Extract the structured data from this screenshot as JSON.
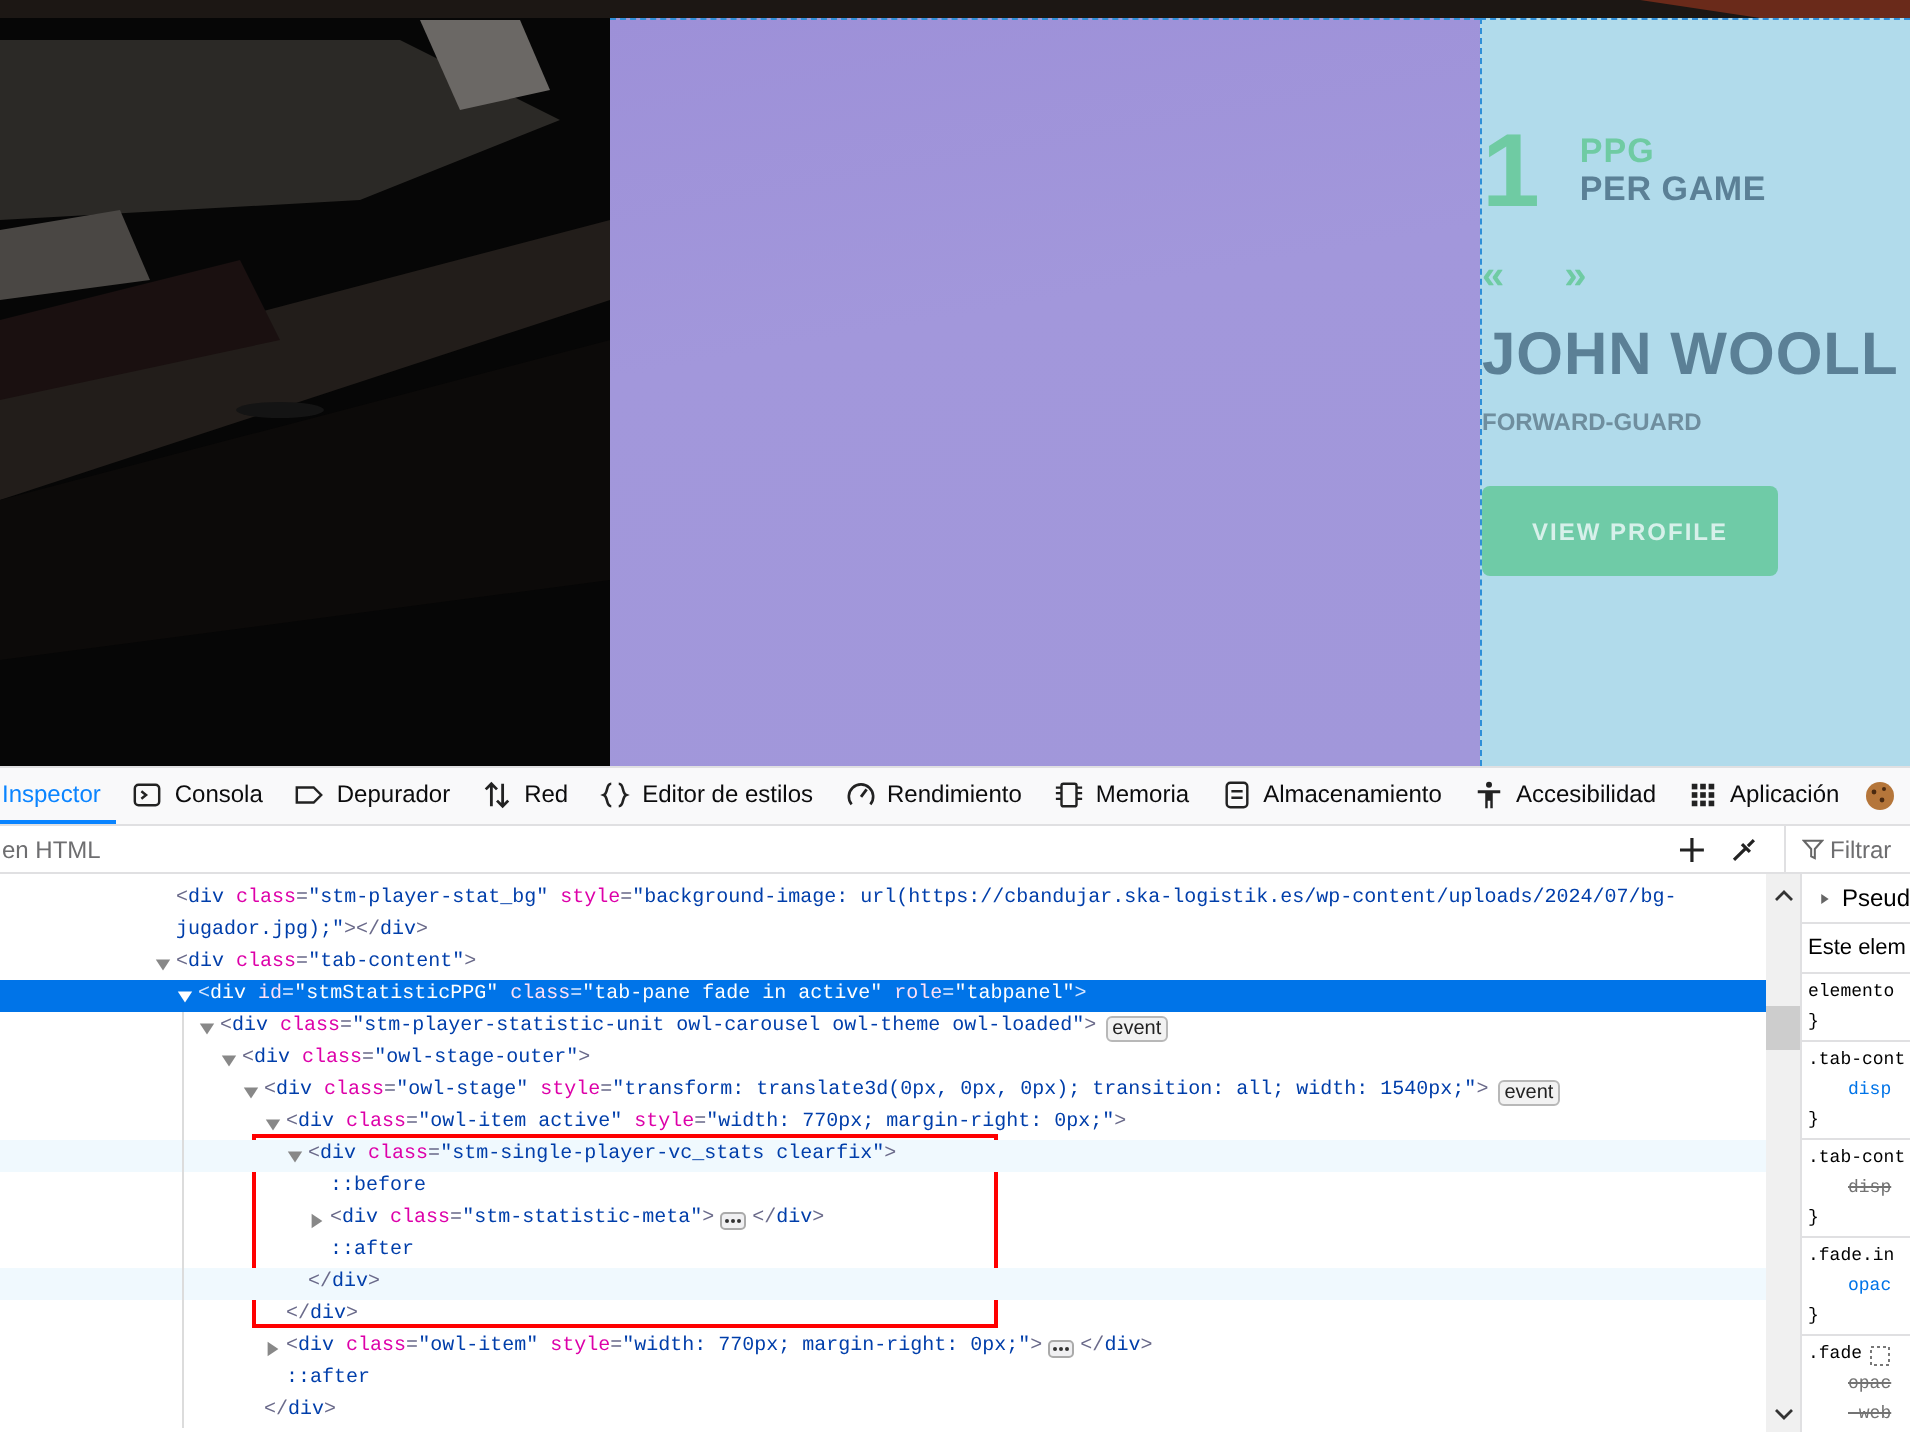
{
  "page": {
    "stat_number": "1",
    "stat_abbr": "PPG",
    "stat_label": "PER GAME",
    "prev_arrow": "«",
    "next_arrow": "»",
    "player_name": "JOHN WOOLL",
    "position": "FORWARD-GUARD",
    "profile_button": "VIEW PROFILE"
  },
  "toolbar": {
    "tabs": [
      {
        "label": "Inspector",
        "selected": true
      },
      {
        "label": "Consola",
        "selected": false
      },
      {
        "label": "Depurador",
        "selected": false
      },
      {
        "label": "Red",
        "selected": false
      },
      {
        "label": "Editor de estilos",
        "selected": false
      },
      {
        "label": "Rendimiento",
        "selected": false
      },
      {
        "label": "Memoria",
        "selected": false
      },
      {
        "label": "Almacenamiento",
        "selected": false
      },
      {
        "label": "Accesibilidad",
        "selected": false
      },
      {
        "label": "Aplicación",
        "selected": false
      }
    ]
  },
  "markup": {
    "search": {
      "placeholder": "en HTML"
    },
    "nodes": [
      {
        "kind": "leaf",
        "selected": false,
        "hovered": false,
        "code": [
          {
            "kind": "punct",
            "text": "<"
          },
          {
            "kind": "tag",
            "text": "div"
          },
          {
            "kind": "attr",
            "text": " class"
          },
          {
            "kind": "punct",
            "text": "="
          },
          {
            "kind": "value",
            "text": "\"stm-player-stat_bg\""
          },
          {
            "kind": "attr",
            "text": " style"
          },
          {
            "kind": "punct",
            "text": "="
          },
          {
            "kind": "value",
            "text": "\"background-image: url(https://cbandujar.ska-logistik.es/wp-content/uploads/2024/07/bg-jugador.jpg);\""
          },
          {
            "kind": "punct",
            "text": "></"
          },
          {
            "kind": "tag",
            "text": "div"
          },
          {
            "kind": "punct",
            "text": ">"
          }
        ]
      },
      {
        "kind": "parent",
        "expanded": true,
        "selected": false,
        "hovered": false,
        "code": [
          {
            "kind": "punct",
            "text": "<"
          },
          {
            "kind": "tag",
            "text": "div"
          },
          {
            "kind": "attr",
            "text": " class"
          },
          {
            "kind": "punct",
            "text": "="
          },
          {
            "kind": "value",
            "text": "\"tab-content\""
          },
          {
            "kind": "punct",
            "text": ">"
          }
        ],
        "children": [
          {
            "kind": "parent",
            "expanded": true,
            "selected": true,
            "hovered": false,
            "code": [
              {
                "kind": "punct",
                "text": "<"
              },
              {
                "kind": "tag",
                "text": "div"
              },
              {
                "kind": "attr",
                "text": " id"
              },
              {
                "kind": "punct",
                "text": "="
              },
              {
                "kind": "value",
                "text": "\"stmStatisticPPG\""
              },
              {
                "kind": "attr",
                "text": " class"
              },
              {
                "kind": "punct",
                "text": "="
              },
              {
                "kind": "value",
                "text": "\"tab-pane fade in active\""
              },
              {
                "kind": "attr",
                "text": " role"
              },
              {
                "kind": "punct",
                "text": "="
              },
              {
                "kind": "value",
                "text": "\"tabpanel\""
              },
              {
                "kind": "punct",
                "text": ">"
              }
            ],
            "children": [
              {
                "kind": "parent",
                "expanded": true,
                "selected": false,
                "hovered": false,
                "badge": "event",
                "code": [
                  {
                    "kind": "punct",
                    "text": "<"
                  },
                  {
                    "kind": "tag",
                    "text": "div"
                  },
                  {
                    "kind": "attr",
                    "text": " class"
                  },
                  {
                    "kind": "punct",
                    "text": "="
                  },
                  {
                    "kind": "value",
                    "text": "\"stm-player-statistic-unit owl-carousel owl-theme owl-loaded\""
                  },
                  {
                    "kind": "punct",
                    "text": ">"
                  }
                ],
                "children": [
                  {
                    "kind": "parent",
                    "expanded": true,
                    "selected": false,
                    "hovered": false,
                    "code": [
                      {
                        "kind": "punct",
                        "text": "<"
                      },
                      {
                        "kind": "tag",
                        "text": "div"
                      },
                      {
                        "kind": "attr",
                        "text": " class"
                      },
                      {
                        "kind": "punct",
                        "text": "="
                      },
                      {
                        "kind": "value",
                        "text": "\"owl-stage-outer\""
                      },
                      {
                        "kind": "punct",
                        "text": ">"
                      }
                    ],
                    "children": [
                      {
                        "kind": "parent",
                        "expanded": true,
                        "selected": false,
                        "hovered": false,
                        "badge": "event",
                        "code": [
                          {
                            "kind": "punct",
                            "text": "<"
                          },
                          {
                            "kind": "tag",
                            "text": "div"
                          },
                          {
                            "kind": "attr",
                            "text": " class"
                          },
                          {
                            "kind": "punct",
                            "text": "="
                          },
                          {
                            "kind": "value",
                            "text": "\"owl-stage\""
                          },
                          {
                            "kind": "attr",
                            "text": " style"
                          },
                          {
                            "kind": "punct",
                            "text": "="
                          },
                          {
                            "kind": "value",
                            "text": "\"transform: translate3d(0px, 0px, 0px); transition: all; width: 1540px;\""
                          },
                          {
                            "kind": "punct",
                            "text": ">"
                          }
                        ],
                        "children": [
                          {
                            "kind": "parent",
                            "expanded": true,
                            "selected": false,
                            "hovered": false,
                            "code": [
                              {
                                "kind": "punct",
                                "text": "<"
                              },
                              {
                                "kind": "tag",
                                "text": "div"
                              },
                              {
                                "kind": "attr",
                                "text": " class"
                              },
                              {
                                "kind": "punct",
                                "text": "="
                              },
                              {
                                "kind": "value",
                                "text": "\"owl-item active\""
                              },
                              {
                                "kind": "attr",
                                "text": " style"
                              },
                              {
                                "kind": "punct",
                                "text": "="
                              },
                              {
                                "kind": "value",
                                "text": "\"width: 770px; margin-right: 0px;\""
                              },
                              {
                                "kind": "punct",
                                "text": ">"
                              }
                            ],
                            "children": [
                              {
                                "kind": "parent",
                                "expanded": true,
                                "selected": false,
                                "hovered": true,
                                "code": [
                                  {
                                    "kind": "punct",
                                    "text": "<"
                                  },
                                  {
                                    "kind": "tag",
                                    "text": "div"
                                  },
                                  {
                                    "kind": "attr",
                                    "text": " class"
                                  },
                                  {
                                    "kind": "punct",
                                    "text": "="
                                  },
                                  {
                                    "kind": "value",
                                    "text": "\"stm-single-player-vc_stats clearfix\""
                                  },
                                  {
                                    "kind": "punct",
                                    "text": ">"
                                  }
                                ],
                                "children": [
                                  {
                                    "kind": "leaf",
                                    "selected": false,
                                    "hovered": false,
                                    "code": [
                                      {
                                        "kind": "pseudo",
                                        "text": "::before"
                                      }
                                    ]
                                  },
                                  {
                                    "kind": "parent",
                                    "expanded": false,
                                    "selected": false,
                                    "hovered": false,
                                    "code": [
                                      {
                                        "kind": "punct",
                                        "text": "<"
                                      },
                                      {
                                        "kind": "tag",
                                        "text": "div"
                                      },
                                      {
                                        "kind": "attr",
                                        "text": " class"
                                      },
                                      {
                                        "kind": "punct",
                                        "text": "="
                                      },
                                      {
                                        "kind": "value",
                                        "text": "\"stm-statistic-meta\""
                                      },
                                      {
                                        "kind": "punct",
                                        "text": ">"
                                      }
                                    ],
                                    "tail": [
                                      {
                                        "kind": "punct",
                                        "text": "</"
                                      },
                                      {
                                        "kind": "tag",
                                        "text": "div"
                                      },
                                      {
                                        "kind": "punct",
                                        "text": ">"
                                      }
                                    ]
                                  },
                                  {
                                    "kind": "leaf",
                                    "selected": false,
                                    "hovered": false,
                                    "code": [
                                      {
                                        "kind": "pseudo",
                                        "text": "::after"
                                      }
                                    ]
                                  }
                                ],
                                "closing": {
                                  "hovered": true,
                                  "code": [
                                    {
                                      "kind": "punct",
                                      "text": "</"
                                    },
                                    {
                                      "kind": "tag",
                                      "text": "div"
                                    },
                                    {
                                      "kind": "punct",
                                      "text": ">"
                                    }
                                  ]
                                }
                              }
                            ],
                            "closing": {
                              "hovered": false,
                              "code": [
                                {
                                  "kind": "punct",
                                  "text": "</"
                                },
                                {
                                  "kind": "tag",
                                  "text": "div"
                                },
                                {
                                  "kind": "punct",
                                  "text": ">"
                                }
                              ]
                            }
                          },
                          {
                            "kind": "parent",
                            "expanded": false,
                            "selected": false,
                            "hovered": false,
                            "code": [
                              {
                                "kind": "punct",
                                "text": "<"
                              },
                              {
                                "kind": "tag",
                                "text": "div"
                              },
                              {
                                "kind": "attr",
                                "text": " class"
                              },
                              {
                                "kind": "punct",
                                "text": "="
                              },
                              {
                                "kind": "value",
                                "text": "\"owl-item\""
                              },
                              {
                                "kind": "attr",
                                "text": " style"
                              },
                              {
                                "kind": "punct",
                                "text": "="
                              },
                              {
                                "kind": "value",
                                "text": "\"width: 770px; margin-right: 0px;\""
                              },
                              {
                                "kind": "punct",
                                "text": ">"
                              }
                            ],
                            "tail": [
                              {
                                "kind": "punct",
                                "text": "</"
                              },
                              {
                                "kind": "tag",
                                "text": "div"
                              },
                              {
                                "kind": "punct",
                                "text": ">"
                              }
                            ]
                          },
                          {
                            "kind": "leaf",
                            "selected": false,
                            "hovered": false,
                            "code": [
                              {
                                "kind": "pseudo",
                                "text": "::after"
                              }
                            ]
                          }
                        ],
                        "closing": {
                          "hovered": false,
                          "code": [
                            {
                              "kind": "punct",
                              "text": "</"
                            },
                            {
                              "kind": "tag",
                              "text": "div"
                            },
                            {
                              "kind": "punct",
                              "text": ">"
                            }
                          ]
                        }
                      }
                    ]
                  }
                ]
              }
            ]
          }
        ]
      }
    ]
  },
  "rules": {
    "filter_placeholder": "Filtrar",
    "pseudo_label": "Pseud",
    "element_label": "Este elem",
    "rules": [
      {
        "kind": "plain",
        "selector": "elemento",
        "close": "}"
      },
      {
        "kind": "plain",
        "selector": ".tab-cont",
        "declarations": [
          {
            "text": "disp",
            "overridden": false
          }
        ],
        "close": "}"
      },
      {
        "kind": "plain",
        "selector": ".tab-cont",
        "declarations": [
          {
            "text": "disp",
            "overridden": true
          }
        ],
        "close": "}"
      },
      {
        "kind": "plain",
        "selector": ".fade.in",
        "declarations": [
          {
            "text": "opac",
            "overridden": false
          }
        ],
        "close": "}"
      },
      {
        "kind": "with-highlighter",
        "selector": ".fade",
        "declarations": [
          {
            "text": "opac",
            "overridden": true
          },
          {
            "text": "-web",
            "overridden": true
          }
        ]
      }
    ]
  }
}
